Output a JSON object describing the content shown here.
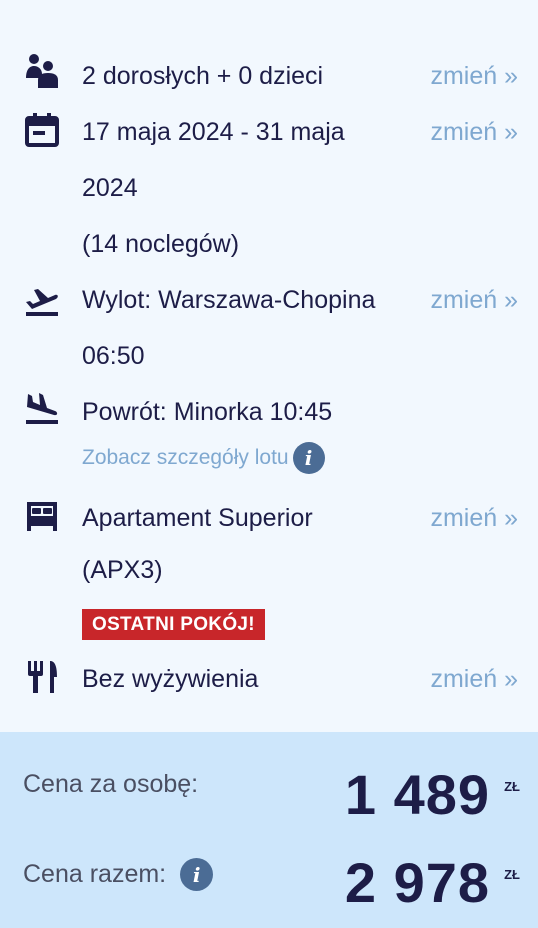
{
  "travelers": {
    "text": "2 dorosłych + 0 dzieci",
    "change": "zmień »"
  },
  "dates": {
    "line1": "17 maja 2024 - 31 maja",
    "line2": "2024",
    "nights": "(14 noclegów)",
    "change": "zmień »"
  },
  "departure": {
    "line1": "Wylot: Warszawa-Chopina",
    "line2": "06:50",
    "change": "zmień »"
  },
  "return_flight": {
    "text": "Powrót: Minorka 10:45",
    "details_link": "Zobacz szczegóły lotu",
    "info": "i"
  },
  "room": {
    "line1": "Apartament Superior",
    "line2": "(APX3)",
    "badge": "OSTATNI POKÓJ!",
    "change": "zmień »"
  },
  "board": {
    "text": "Bez wyżywienia",
    "change": "zmień »"
  },
  "pricing": {
    "per_person_label": "Cena za osobę:",
    "per_person_value": "1 489",
    "total_label": "Cena razem:",
    "total_value": "2 978",
    "currency": "ZŁ",
    "info": "i"
  },
  "colors": {
    "text": "#1d1d47",
    "link": "#7fa8d0",
    "badge": "#c8262a",
    "panel": "#cde6fb",
    "background": "#f2f8fe"
  }
}
